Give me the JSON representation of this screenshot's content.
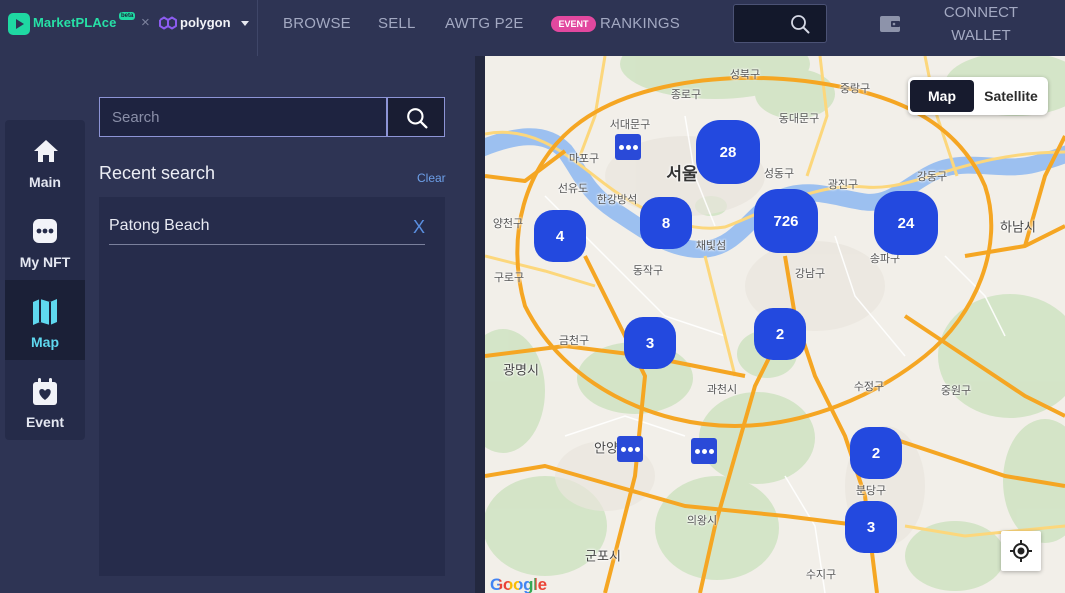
{
  "header": {
    "logo": {
      "text": "MarketPLAce",
      "badge": "beta",
      "icon": "play-logo-icon"
    },
    "cross": "×",
    "partner": {
      "text": "polygon",
      "icon": "polygon-logo-icon"
    },
    "nav": [
      {
        "label": "BROWSE"
      },
      {
        "label": "SELL"
      },
      {
        "label": "AWTG P2E"
      },
      {
        "label": "RANKINGS",
        "badge": "EVENT"
      }
    ],
    "search": {
      "value": "",
      "icon": "search-icon"
    },
    "wallet_icon": "wallet-icon",
    "connect": {
      "line1": "CONNECT",
      "line2": "WALLET"
    }
  },
  "sidenav": {
    "items": [
      {
        "label": "Main",
        "icon": "home-icon",
        "active": false
      },
      {
        "label": "My NFT",
        "icon": "nft-icon",
        "active": false
      },
      {
        "label": "Map",
        "icon": "map-icon",
        "active": true
      },
      {
        "label": "Event",
        "icon": "event-calendar-icon",
        "active": false
      }
    ]
  },
  "panel": {
    "search": {
      "placeholder": "Search",
      "value": "",
      "icon": "search-icon"
    },
    "recent_title": "Recent search",
    "clear_label": "Clear",
    "recent_items": [
      {
        "text": "Patong Beach",
        "remove_label": "X"
      }
    ]
  },
  "map": {
    "type_control": {
      "options": [
        {
          "label": "Map",
          "selected": true
        },
        {
          "label": "Satellite",
          "selected": false
        }
      ]
    },
    "clusters": [
      {
        "count": 28
      },
      {
        "count": 4
      },
      {
        "count": 8
      },
      {
        "count": 726
      },
      {
        "count": 24
      },
      {
        "count": 3
      },
      {
        "count": 2
      },
      {
        "count": 2
      },
      {
        "count": 3
      }
    ],
    "small_markers": [
      {
        "icon": "more-dots-icon"
      },
      {
        "icon": "more-dots-icon"
      },
      {
        "icon": "more-dots-icon"
      }
    ],
    "labels": [
      "성북구",
      "종로구",
      "서대문구",
      "동대문구",
      "중랑구",
      "마포구",
      "서울",
      "성동구",
      "광진구",
      "강동구",
      "선유도",
      "한강방석",
      "양천구",
      "하남시",
      "채빛섬",
      "동작구",
      "강남구",
      "송파구",
      "구로구",
      "금천구",
      "광명시",
      "과천시",
      "수정구",
      "중원구",
      "안양",
      "분당구",
      "의왕시",
      "군포시",
      "수지구"
    ],
    "logo": "Google",
    "locate_icon": "my-location-icon"
  },
  "colors": {
    "background": "#2e3454",
    "panel": "#262c4b",
    "accent_green": "#27e0a6",
    "active_nav": "#5fd8ef",
    "event_badge": "#e2489f",
    "cluster_blue": "#2349df",
    "link_blue": "#6d9fe8"
  }
}
